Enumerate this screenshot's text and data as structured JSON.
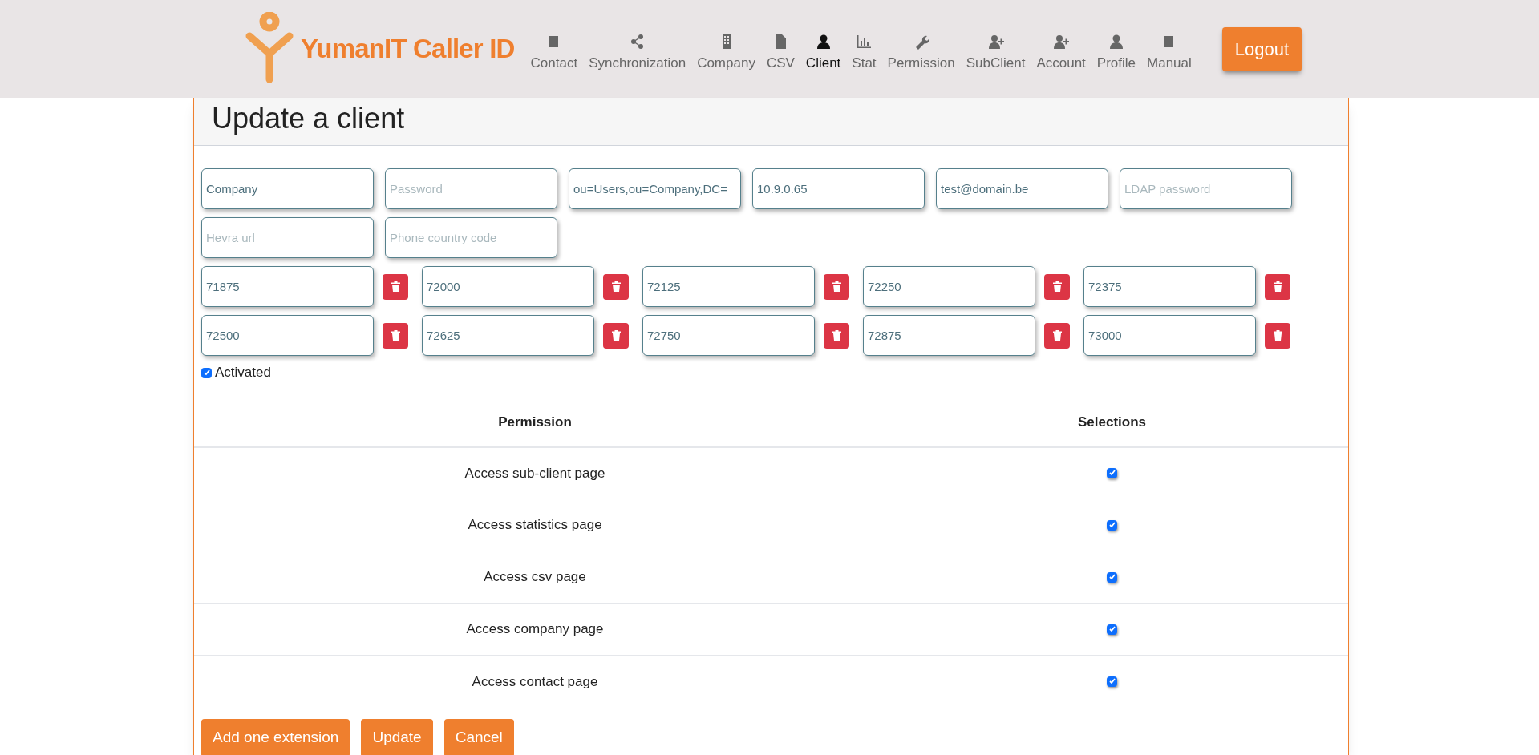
{
  "brand": "YumanIT Caller ID",
  "nav": [
    {
      "label": "Contact",
      "selected": false
    },
    {
      "label": "Synchronization",
      "selected": false
    },
    {
      "label": "Company",
      "selected": false
    },
    {
      "label": "CSV",
      "selected": false
    },
    {
      "label": "Client",
      "selected": true
    },
    {
      "label": "Stat",
      "selected": false
    },
    {
      "label": "Permission",
      "selected": false
    },
    {
      "label": "SubClient",
      "selected": false
    },
    {
      "label": "Account",
      "selected": false
    },
    {
      "label": "Profile",
      "selected": false
    },
    {
      "label": "Manual",
      "selected": false
    }
  ],
  "logout": "Logout",
  "card_title": "Update a client",
  "fields": [
    {
      "value": "Company"
    },
    {
      "placeholder": "Password"
    },
    {
      "value": "ou=Users,ou=Company,DC="
    },
    {
      "value": "10.9.0.65"
    },
    {
      "value": "test@domain.be"
    },
    {
      "placeholder": "LDAP password"
    },
    {
      "placeholder": "Hevra url"
    },
    {
      "placeholder": "Phone country code"
    }
  ],
  "extensions": [
    "71875",
    "72000",
    "72125",
    "72250",
    "72375",
    "72500",
    "72625",
    "72750",
    "72875",
    "73000"
  ],
  "activated": {
    "label": "Activated",
    "checked": true
  },
  "permissions_table": {
    "columns": [
      "Permission",
      "Selections"
    ],
    "rows": [
      {
        "permission": "Access sub-client page",
        "checked": true
      },
      {
        "permission": "Access statistics page",
        "checked": true
      },
      {
        "permission": "Access csv page",
        "checked": true
      },
      {
        "permission": "Access company page",
        "checked": true
      },
      {
        "permission": "Access contact page",
        "checked": true
      }
    ]
  },
  "buttons": [
    "Add one extension",
    "Update",
    "Cancel"
  ]
}
